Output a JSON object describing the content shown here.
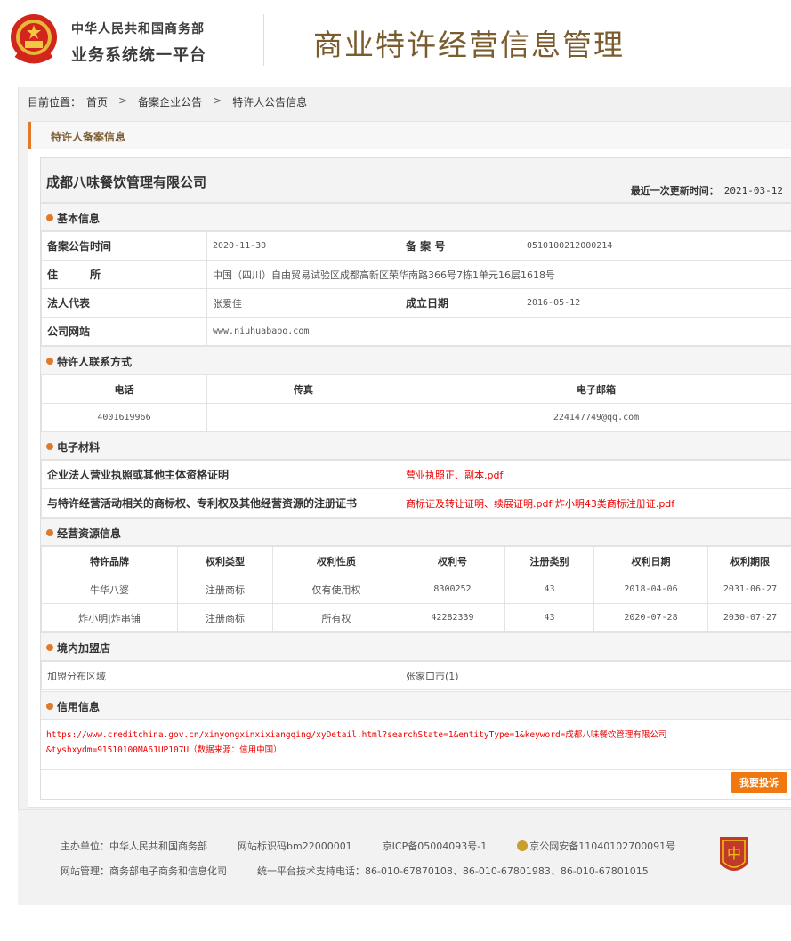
{
  "header": {
    "gov_line1": "中华人民共和国商务部",
    "gov_line2": "业务系统统一平台",
    "site_title": "商业特许经营信息管理"
  },
  "breadcrumb": {
    "prefix": "目前位置：",
    "items": [
      "首页",
      "备案企业公告",
      "特许人公告信息"
    ]
  },
  "panel_title": "特许人备案信息",
  "company": {
    "name": "成都八味餐饮管理有限公司",
    "update_label": "最近一次更新时间：",
    "update_value": "2021-03-12"
  },
  "basic_info": {
    "section_title": "基本信息",
    "announce_label": "备案公告时间",
    "announce_value": "2020-11-30",
    "record_no_label": "备 案 号",
    "record_no_value": "0510100212000214",
    "address_label": "住　　　所",
    "address_value": "中国（四川）自由贸易试验区成都高新区荣华南路366号7栋1单元16层1618号",
    "legal_label": "法人代表",
    "legal_value": "张爱佳",
    "established_label": "成立日期",
    "established_value": "2016-05-12",
    "website_label": "公司网站",
    "website_value": "www.niuhuabapo.com"
  },
  "contact": {
    "section_title": "特许人联系方式",
    "phone_label": "电话",
    "fax_label": "传真",
    "email_label": "电子邮箱",
    "phone_value": "4001619966",
    "fax_value": "",
    "email_value": "224147749@qq.com"
  },
  "materials": {
    "section_title": "电子材料",
    "rows": [
      {
        "label": "企业法人营业执照或其他主体资格证明",
        "value": "营业执照正、副本.pdf"
      },
      {
        "label": "与特许经营活动相关的商标权、专利权及其他经营资源的注册证书",
        "value": "商标证及转让证明、续展证明.pdf 炸小明43类商标注册证.pdf"
      }
    ]
  },
  "resources": {
    "section_title": "经营资源信息",
    "headers": [
      "特许品牌",
      "权利类型",
      "权利性质",
      "权利号",
      "注册类别",
      "权利日期",
      "权利期限"
    ],
    "rows": [
      [
        "牛华八婆",
        "注册商标",
        "仅有使用权",
        "8300252",
        "43",
        "2018-04-06",
        "2031-06-27"
      ],
      [
        "炸小明|炸串铺",
        "注册商标",
        "所有权",
        "42282339",
        "43",
        "2020-07-28",
        "2030-07-27"
      ]
    ]
  },
  "franchise": {
    "section_title": "境内加盟店",
    "area_label": "加盟分布区域",
    "area_value": "张家口市(1)"
  },
  "credit": {
    "section_title": "信用信息",
    "line1": "https://www.creditchina.gov.cn/xinyongxinxixiangqing/xyDetail.html?searchState=1&entityType=1&keyword=成都八味餐饮管理有限公司",
    "line2": "&tyshxydm=91510100MA61UP107U（数据来源：信用中国）"
  },
  "complain_button": "我要投诉",
  "footer": {
    "host": "主办单位：中华人民共和国商务部",
    "site_code": "网站标识码bm22000001",
    "icp": "京ICP备05004093号-1",
    "police": "京公网安备11040102700091号",
    "manager": "网站管理：商务部电子商务和信息化司",
    "support": "统一平台技术支持电话：86-010-67870108、86-010-67801983、86-010-67801015"
  },
  "colors": {
    "accent": "#e07a2a",
    "title_brown": "#7a5c2e",
    "link_red": "#e00000",
    "button_orange": "#f0780f"
  }
}
